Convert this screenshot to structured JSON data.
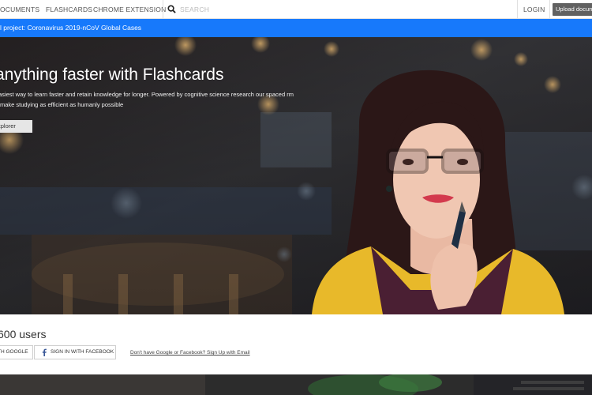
{
  "nav": {
    "documents": "OCUMENTS",
    "flashcards": "FLASHCARDS",
    "chrome_extension": "CHROME EXTENSION",
    "search_placeholder": "SEARCH",
    "login": "LOGIN",
    "upload": "Upload docume"
  },
  "banner": {
    "text": "l project: Coronavirus 2019-nCoV Global Cases"
  },
  "hero": {
    "title": "anything faster with Flashcards",
    "subtitle": "asiest way to learn faster and retain knowledge for longer. Powered by cognitive science research our spaced rm make studying as efficient as humanly possible",
    "explorer_button": "xplorer"
  },
  "signup": {
    "users_count": "600 users",
    "google_button": "TH GOOGLE",
    "facebook_button": "SIGN IN WITH FACEBOOK",
    "email_link": "Don't have Google or Facebook? Sign Up with Email"
  },
  "colors": {
    "banner": "#1779fb",
    "upload_button": "#616161",
    "hero_sweater": "#e8b92a"
  },
  "icons": {
    "search": "search-icon",
    "facebook": "facebook-icon"
  }
}
